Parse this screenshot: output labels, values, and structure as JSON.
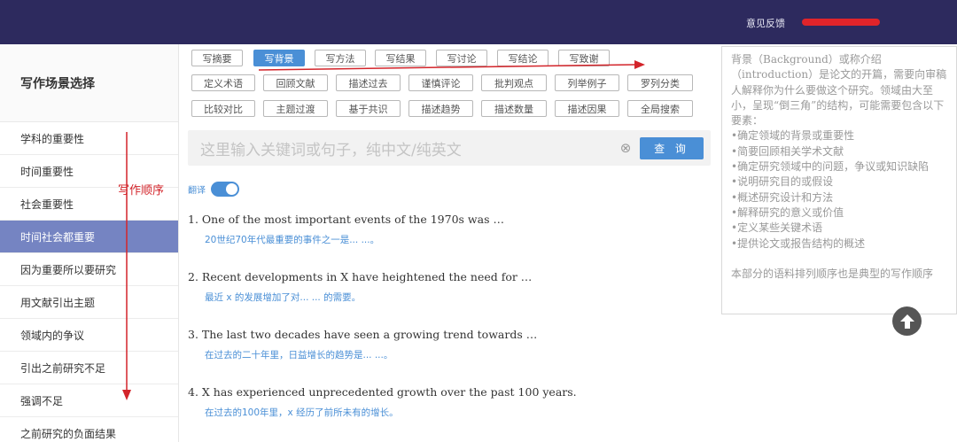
{
  "topbar": {
    "feedback_label": "意见反馈"
  },
  "sidebar": {
    "title": "写作场景选择",
    "items": [
      {
        "label": "学科的重要性"
      },
      {
        "label": "时间重要性"
      },
      {
        "label": "社会重要性"
      },
      {
        "label": "时间社会都重要"
      },
      {
        "label": "因为重要所以要研究"
      },
      {
        "label": "用文献引出主题"
      },
      {
        "label": "领域内的争议"
      },
      {
        "label": "引出之前研究不足"
      },
      {
        "label": "强调不足"
      },
      {
        "label": "之前研究的负面结果"
      }
    ],
    "active_index": 3
  },
  "tags": {
    "row1": [
      "写摘要",
      "写背景",
      "写方法",
      "写结果",
      "写讨论",
      "写结论",
      "写致谢"
    ],
    "row2": [
      "定义术语",
      "回顾文献",
      "描述过去",
      "谨慎评论",
      "批判观点",
      "列举例子",
      "罗列分类"
    ],
    "row3": [
      "比较对比",
      "主题过渡",
      "基于共识",
      "描述趋势",
      "描述数量",
      "描述因果",
      "全局搜索"
    ],
    "active_tag": "写背景"
  },
  "search": {
    "placeholder": "这里输入关键词或句子，纯中文/纯英文",
    "button_label": "查 询",
    "clear_glyph": "⊗"
  },
  "translate": {
    "label": "翻译",
    "enabled": true
  },
  "sentences": [
    {
      "num": "1.",
      "en": "One of the most important events of the 1970s was …",
      "zh": "20世纪70年代最重要的事件之一是... ...。"
    },
    {
      "num": "2.",
      "en": "Recent developments in X have heightened the need for …",
      "zh": "最近 x 的发展增加了对... ... 的需要。"
    },
    {
      "num": "3.",
      "en": "The last two decades have seen a growing trend towards …",
      "zh": "在过去的二十年里，日益增长的趋势是... ...。"
    },
    {
      "num": "4.",
      "en": "X has experienced unprecedented growth over the past 100 years.",
      "zh": "在过去的100年里，x 经历了前所未有的增长。"
    }
  ],
  "right_panel": {
    "text": "背景（Background）或称介绍（introduction）是论文的开篇，需要向审稿人解释你为什么要做这个研究。领域由大至小，呈现“倒三角”的结构，可能需要包含以下要素：\n•确定领域的背景或重要性\n•简要回顾相关学术文献\n•确定研究领域中的问题，争议或知识缺陷\n•说明研究目的或假设\n•概述研究设计和方法\n•解释研究的意义或价值\n•定义某些关键术语\n•提供论文或报告结构的概述\n\n本部分的语料排列顺序也是典型的写作顺序"
  },
  "annotation": {
    "label": "写作顺序",
    "color": "#d3242a"
  },
  "colors": {
    "topbar": "#2d2a5e",
    "accent": "#4a8fd6",
    "sidebar_active": "#7584c2",
    "annotation": "#d3242a"
  },
  "icons": {
    "scroll_top": "arrow-up-circle-icon",
    "clear": "clear-circle-icon"
  }
}
